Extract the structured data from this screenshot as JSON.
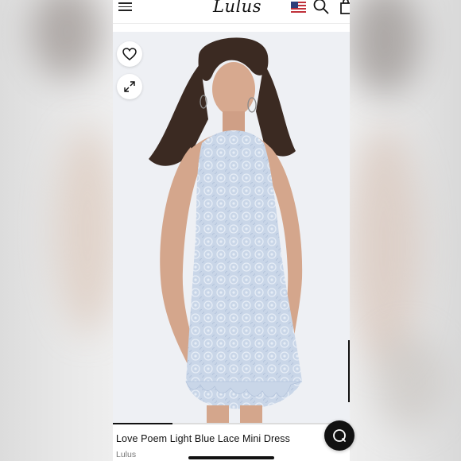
{
  "header": {
    "logo_text": "Lulus",
    "menu_icon": "hamburger-menu-icon",
    "region_icon": "us-flag-icon",
    "search_icon": "search-icon",
    "bag_icon": "shopping-bag-icon"
  },
  "product": {
    "name": "Love Poem Light Blue Lace Mini Dress",
    "brand": "Lulus",
    "dress_color": "#c9d6e8",
    "favorite_icon": "heart-icon",
    "expand_icon": "expand-arrows-icon",
    "image_carousel_progress": 0.25
  },
  "chat": {
    "icon": "chat-bubble-icon"
  },
  "colors": {
    "accent": "#111111",
    "background": "#eef0f4"
  }
}
